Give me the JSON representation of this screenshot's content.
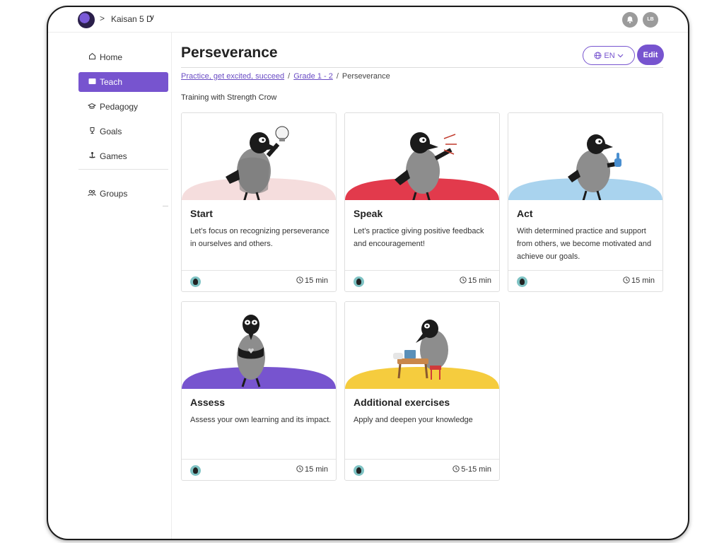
{
  "topbar": {
    "org_name": "Kaisan 5 D",
    "separator": ">",
    "chevron": "∨",
    "bell_icon": "🔔",
    "user_initials": "LB"
  },
  "sidebar": {
    "items": [
      {
        "label": "Home",
        "icon": "home-icon",
        "glyph": "⌂"
      },
      {
        "label": "Teach",
        "icon": "book-icon",
        "glyph": "▬"
      },
      {
        "label": "Pedagogy",
        "icon": "graduation-cap-icon",
        "glyph": "⌂"
      },
      {
        "label": "Goals",
        "icon": "trophy-icon",
        "glyph": "♀"
      },
      {
        "label": "Games",
        "icon": "joystick-icon",
        "glyph": "⚓"
      },
      {
        "label": "Groups",
        "icon": "groups-icon",
        "glyph": "☺"
      }
    ],
    "active": "Teach"
  },
  "main": {
    "title": "Perseverance",
    "language": "EN",
    "edit_label": "Edit",
    "breadcrumb": [
      "Practice, get excited, succeed",
      "Grade 1 - 2",
      "Perseverance"
    ],
    "breadcrumb_sep": "/",
    "subtitle": "Training with Strength Crow"
  },
  "cards": [
    {
      "name": "Start",
      "desc": "Let’s focus on recognizing perseverance in ourselves and others.",
      "duration": "15 min",
      "accent": "#f5dddd",
      "icon": "crow-lightbulb-illustration"
    },
    {
      "name": "Speak",
      "desc": "Let’s practice giving positive feedback and encouragement!",
      "duration": "15 min",
      "accent": "#e23a4c",
      "icon": "crow-speaking-illustration"
    },
    {
      "name": "Act",
      "desc": "With determined practice and support from others, we become motivated and achieve our goals.",
      "duration": "15 min",
      "accent": "#a9d3ee",
      "icon": "crow-thumbs-up-illustration"
    },
    {
      "name": "Assess",
      "desc": "Assess your own learning and its impact.",
      "duration": "15 min",
      "accent": "#7754cf",
      "icon": "crow-heart-illustration"
    },
    {
      "name": "Additional exercises",
      "desc": "Apply and deepen your knowledge",
      "duration": "5-15 min",
      "accent": "#f5cc3e",
      "icon": "crow-desk-illustration"
    }
  ],
  "colors": {
    "brand": "#7754cf",
    "link": "#6a4cc4"
  }
}
